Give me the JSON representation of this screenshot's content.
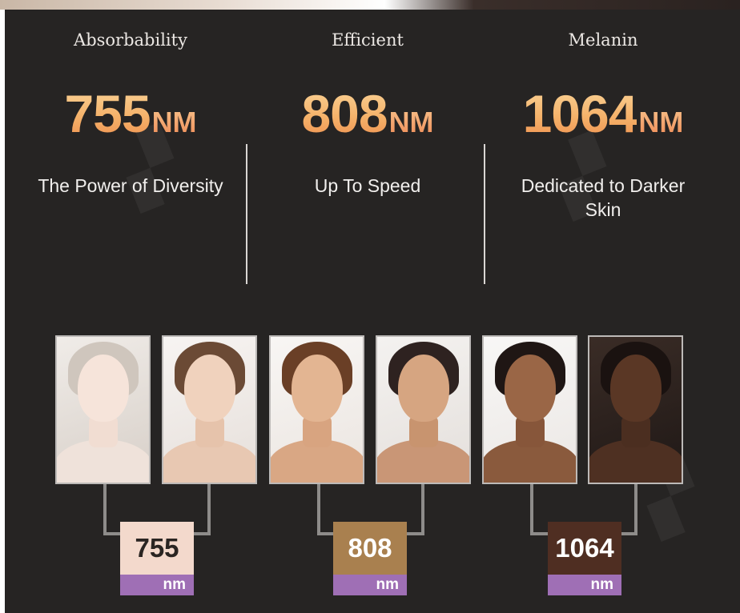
{
  "columns": [
    {
      "heading": "Absorbability",
      "number": "755",
      "unit": "NM",
      "description": "The Power of Diversity"
    },
    {
      "heading": "Efficient",
      "number": "808",
      "unit": "NM",
      "description": "Up To Speed"
    },
    {
      "heading": "Melanin",
      "number": "1064",
      "unit": "NM",
      "description": "Dedicated to Darker Skin"
    }
  ],
  "tags": [
    {
      "value": "755",
      "unit": "nm",
      "color": "#f3d9cc",
      "text_color": "#2a2522"
    },
    {
      "value": "808",
      "unit": "nm",
      "color": "#a9804f",
      "text_color": "#ffffff"
    },
    {
      "value": "1064",
      "unit": "nm",
      "color": "#4f2e22",
      "text_color": "#ffffff"
    }
  ],
  "colors": {
    "background": "#262423",
    "wavelength_gradient_top": "#f9d69b",
    "wavelength_gradient_bottom": "#ee8f4e",
    "unit_bar": "#9f6fb5"
  }
}
